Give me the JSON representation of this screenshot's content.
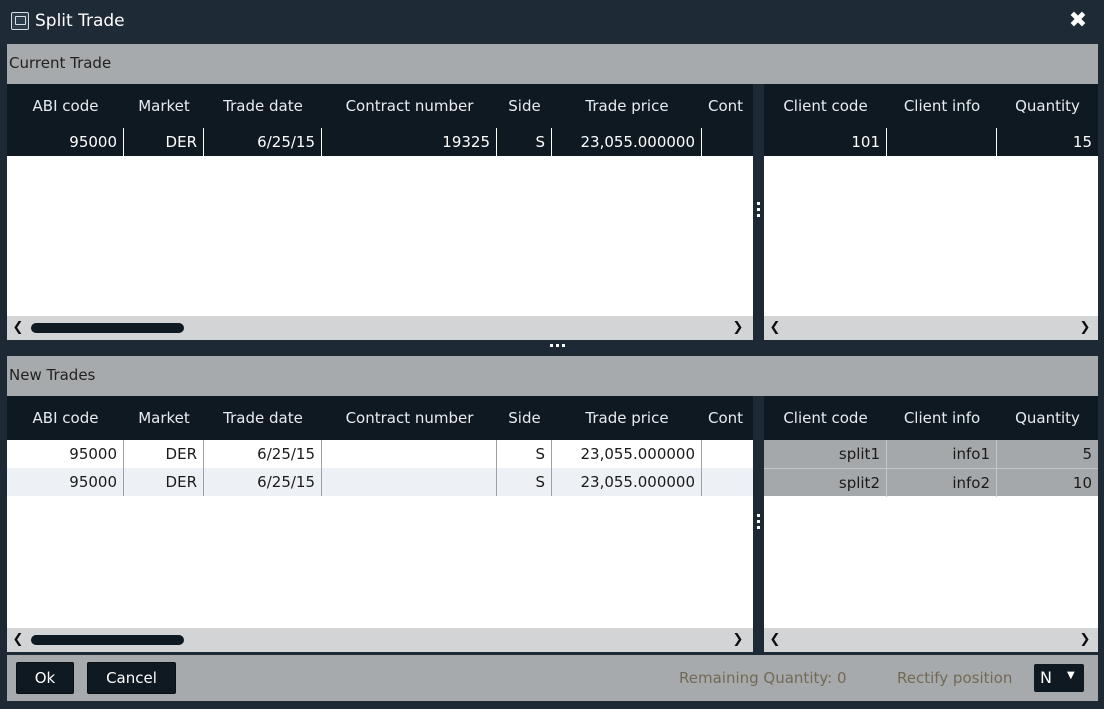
{
  "window": {
    "title": "Split Trade",
    "close_glyph": "✖"
  },
  "current_trade": {
    "label": "Current Trade",
    "left_columns": [
      "ABI code",
      "Market",
      "Trade date",
      "Contract number",
      "Side",
      "Trade price",
      "Cont"
    ],
    "right_columns": [
      "Client code",
      "Client info",
      "Quantity"
    ],
    "rows": [
      {
        "left": [
          "95000",
          "DER",
          "6/25/15",
          "19325",
          "S",
          "23,055.000000",
          ""
        ],
        "right": [
          "101",
          "",
          "15"
        ]
      }
    ]
  },
  "new_trades": {
    "label": "New Trades",
    "left_columns": [
      "ABI code",
      "Market",
      "Trade date",
      "Contract number",
      "Side",
      "Trade price",
      "Cont"
    ],
    "right_columns": [
      "Client code",
      "Client info",
      "Quantity"
    ],
    "rows": [
      {
        "left": [
          "95000",
          "DER",
          "6/25/15",
          "",
          "S",
          "23,055.000000",
          ""
        ],
        "right": [
          "split1",
          "info1",
          "5"
        ]
      },
      {
        "left": [
          "95000",
          "DER",
          "6/25/15",
          "",
          "S",
          "23,055.000000",
          ""
        ],
        "right": [
          "split2",
          "info2",
          "10"
        ]
      }
    ]
  },
  "scroll": {
    "left_arrow": "❮",
    "right_arrow": "❯"
  },
  "footer": {
    "ok_label": "Ok",
    "cancel_label": "Cancel",
    "remaining_quantity": "Remaining Quantity: 0",
    "rectify_label": "Rectify position",
    "rectify_value": "N",
    "caret": "▼"
  },
  "colors": {
    "dark": "#0f1922",
    "frame": "#1d2935",
    "section_bar": "#a7aaac",
    "muted_text": "#726a55"
  },
  "icons": [
    "window-app-icon",
    "close-icon",
    "scroll-left-arrow-icon",
    "scroll-right-arrow-icon",
    "chevron-down-icon",
    "splitter-grip-icon"
  ]
}
